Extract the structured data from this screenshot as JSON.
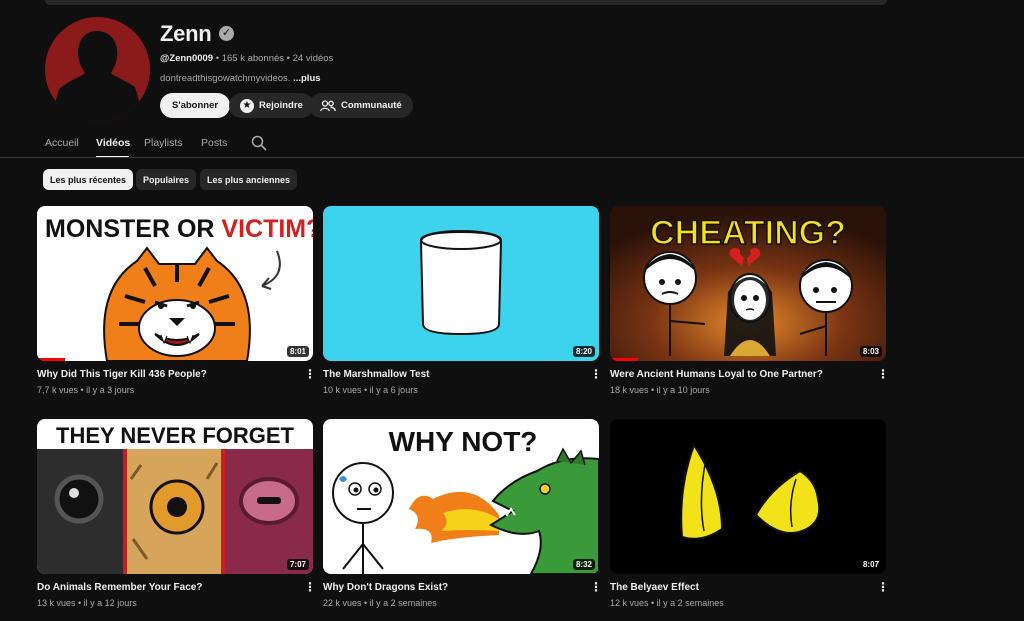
{
  "channel": {
    "name": "Zenn",
    "handle": "@Zenn0009",
    "subscribers": " • 165 k abonnés",
    "videos_count": " • 24 vidéos",
    "description": "dontreadthisgowatchmyvideos.",
    "more_label": " ...plus"
  },
  "buttons": {
    "subscribe": "S'abonner",
    "join": "Rejoindre",
    "community": "Communauté"
  },
  "tabs": {
    "home": "Accueil",
    "videos": "Vidéos",
    "playlists": "Playlists",
    "posts": "Posts"
  },
  "chips": {
    "recent": "Les plus récentes",
    "popular": "Populaires",
    "oldest": "Les plus anciennes"
  },
  "videos": [
    {
      "title": "Why Did This Tiger Kill 436 People?",
      "meta": "7,7 k vues • il y a 3 jours",
      "duration": "8:01",
      "thumb_text_a": "MONSTER OR ",
      "thumb_text_b": "VICTIM?",
      "watched_fraction": 0.1
    },
    {
      "title": "The Marshmallow Test",
      "meta": "10 k vues • il y a 6 jours",
      "duration": "8:20"
    },
    {
      "title": "Were Ancient Humans Loyal to One Partner?",
      "meta": "18 k vues • il y a 10 jours",
      "duration": "8:03",
      "thumb_text": "CHEATING?",
      "watched_fraction": 0.1
    },
    {
      "title": "Do Animals Remember Your Face?",
      "meta": "13 k vues • il y a 12 jours",
      "duration": "7:07",
      "thumb_text": "THEY NEVER FORGET"
    },
    {
      "title": "Why Don't Dragons Exist?",
      "meta": "22 k vues • il y a 2 semaines",
      "duration": "8:32",
      "thumb_text": "WHY NOT?"
    },
    {
      "title": "The Belyaev Effect",
      "meta": "12 k vues • il y a 2 semaines",
      "duration": "8:07"
    }
  ],
  "colors": {
    "background": "#0f0f0f",
    "accent_red": "#ff0000",
    "chip_active": "#f1f1f1",
    "secondary_text": "#aaaaaa"
  }
}
